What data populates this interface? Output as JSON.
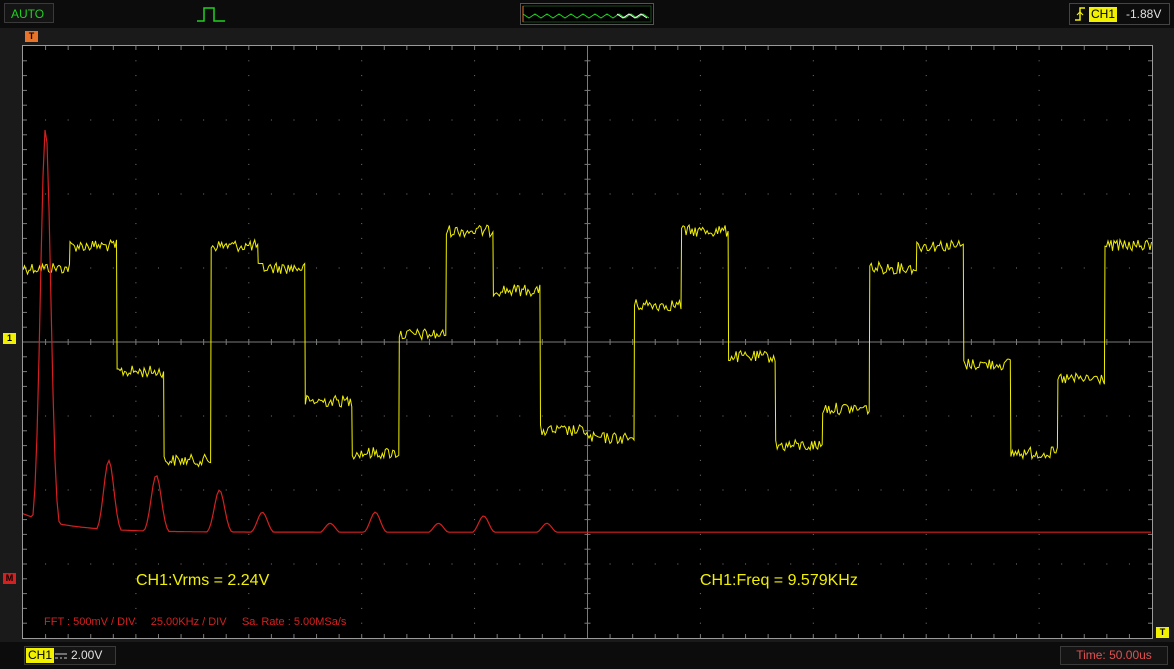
{
  "top_bar": {
    "mode_label": "AUTO",
    "pulse_icon": "pulse-icon",
    "trigger_edge_icon": "rising-edge-icon",
    "trigger_channel": "CH1",
    "trigger_level": "-1.88V"
  },
  "markers": {
    "trigger_position": "T",
    "ch1_ground": "1",
    "math_ref": "M",
    "trigger_level": "T"
  },
  "measurements": {
    "vrms": "CH1:Vrms = 2.24V",
    "freq": "CH1:Freq = 9.579KHz"
  },
  "fft_info": "FFT : 500mV / DIV     25.00KHz / DIV     Sa. Rate : 5.00MSa/s",
  "bottom_bar": {
    "channel": "CH1",
    "coupling_icon": "dc-coupling-icon",
    "volts_per_div": "2.00V",
    "timebase": "Time: 50.00us"
  },
  "colors": {
    "ch1": "#f0f000",
    "math": "#d42020",
    "grid": "#7a7a7a",
    "background": "#000000",
    "mode_text": "#1fd21f",
    "trigger_pos": "#e8742a"
  },
  "grid": {
    "h_divisions": 10,
    "v_divisions": 8
  },
  "ch1_levels_div": [
    1.0,
    1.3,
    -0.4,
    -1.6,
    1.3,
    1.0,
    -0.8,
    -1.5,
    0.1,
    1.5,
    0.7,
    -1.2,
    -1.3,
    0.5,
    1.5,
    -0.2,
    -1.4,
    -0.9,
    1.0,
    1.3,
    -0.3,
    -1.5,
    -0.5,
    1.3
  ],
  "fft_peaks": [
    {
      "freq_khz": 5.0,
      "amp_div": 5.5
    },
    {
      "freq_khz": 19.0,
      "amp_div": 1.0
    },
    {
      "freq_khz": 29.5,
      "amp_div": 0.8
    },
    {
      "freq_khz": 43.5,
      "amp_div": 0.6
    },
    {
      "freq_khz": 53.0,
      "amp_div": 0.3
    },
    {
      "freq_khz": 68.0,
      "amp_div": 0.15
    },
    {
      "freq_khz": 78.0,
      "amp_div": 0.3
    },
    {
      "freq_khz": 92.0,
      "amp_div": 0.15
    },
    {
      "freq_khz": 102.0,
      "amp_div": 0.25
    },
    {
      "freq_khz": 116.0,
      "amp_div": 0.15
    }
  ]
}
